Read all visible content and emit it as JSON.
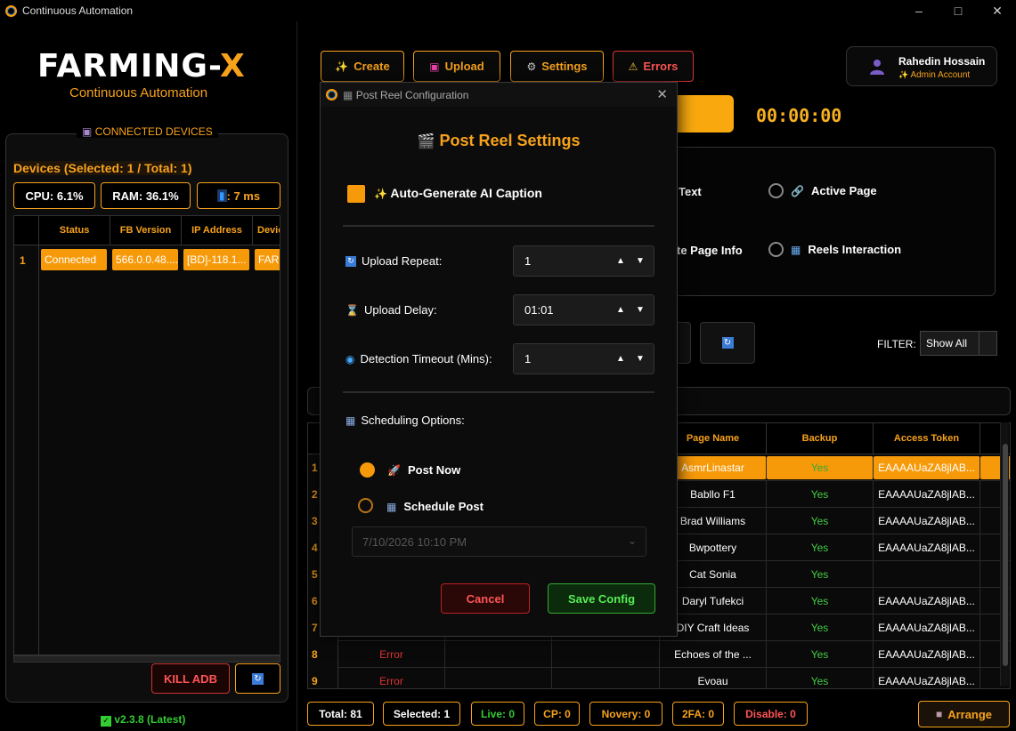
{
  "window": {
    "title": "Continuous Automation"
  },
  "left": {
    "logo_main": "FARMING-",
    "logo_x": "X",
    "logo_sub": "Continuous Automation",
    "devices_legend": "CONNECTED DEVICES",
    "devices_count": "Devices (Selected: 1 / Total: 1)",
    "cpu": "CPU: 6.1%",
    "ram": "RAM: 36.1%",
    "ping": ": 7 ms",
    "table": {
      "headers": [
        "Status",
        "FB Version",
        "IP Address",
        "Devic"
      ],
      "row": {
        "num": "1",
        "status": "Connected",
        "fb_version": "566.0.0.48....",
        "ip": "[BD]-118.1...",
        "device": "FARM"
      }
    },
    "kill_label": "KILL ADB",
    "version": "v2.3.8 (Latest)"
  },
  "toolbar": {
    "create": "Create",
    "upload": "Upload",
    "settings": "Settings",
    "errors": "Errors"
  },
  "user": {
    "name": "Rahedin Hossain",
    "role": "Admin Account"
  },
  "timer": "00:00:00",
  "options": {
    "text_partial": "Text",
    "page_info_partial": "te Page Info",
    "active_page": "Active Page",
    "reels_interaction": "Reels Interaction"
  },
  "filter": {
    "label": "FILTER:",
    "value": "Show All"
  },
  "table": {
    "headers": [
      "Page Name",
      "Backup",
      "Access Token"
    ],
    "rows": [
      {
        "num": "1",
        "status": "",
        "page": "AsmrLinastar",
        "backup": "Yes",
        "token": "EAAAAUaZA8jlAB..."
      },
      {
        "num": "2",
        "status": "",
        "page": "Babllo F1",
        "backup": "Yes",
        "token": "EAAAAUaZA8jlAB..."
      },
      {
        "num": "3",
        "status": "",
        "page": "Brad Williams",
        "backup": "Yes",
        "token": "EAAAAUaZA8jlAB..."
      },
      {
        "num": "4",
        "status": "",
        "page": "Bwpottery",
        "backup": "Yes",
        "token": "EAAAAUaZA8jlAB..."
      },
      {
        "num": "5",
        "status": "",
        "page": "Cat Sonia",
        "backup": "Yes",
        "token": ""
      },
      {
        "num": "6",
        "status": "",
        "page": "Daryl Tufekci",
        "backup": "Yes",
        "token": "EAAAAUaZA8jlAB..."
      },
      {
        "num": "7",
        "status": "",
        "page": "DIY Craft Ideas",
        "backup": "Yes",
        "token": "EAAAAUaZA8jlAB..."
      },
      {
        "num": "8",
        "status": "Error",
        "page": "Echoes of the ...",
        "backup": "Yes",
        "token": "EAAAAUaZA8jlAB..."
      },
      {
        "num": "9",
        "status": "Error",
        "page": "Evoau",
        "backup": "Yes",
        "token": "EAAAAUaZA8jlAB..."
      }
    ]
  },
  "stats": {
    "total": "Total: 81",
    "selected": "Selected: 1",
    "live": "Live: 0",
    "cp": "CP: 0",
    "novery": "Novery: 0",
    "twofa": "2FA: 0",
    "disable": "Disable: 0",
    "arrange": "Arrange"
  },
  "modal": {
    "window_title": "Post Reel Configuration",
    "heading": "Post Reel Settings",
    "ai_caption": "Auto-Generate AI Caption",
    "upload_repeat_label": "Upload Repeat:",
    "upload_repeat_value": "1",
    "upload_delay_label": "Upload Delay:",
    "upload_delay_value": "01:01",
    "detection_timeout_label": "Detection Timeout (Mins):",
    "detection_timeout_value": "1",
    "scheduling_label": "Scheduling Options:",
    "post_now": "Post Now",
    "schedule_post": "Schedule Post",
    "datetime": "7/10/2026 10:10 PM",
    "cancel": "Cancel",
    "save": "Save Config"
  },
  "colors": {
    "accent": "#f7a21b",
    "danger": "#dd3333",
    "success": "#33cc33",
    "bg": "#000000"
  }
}
